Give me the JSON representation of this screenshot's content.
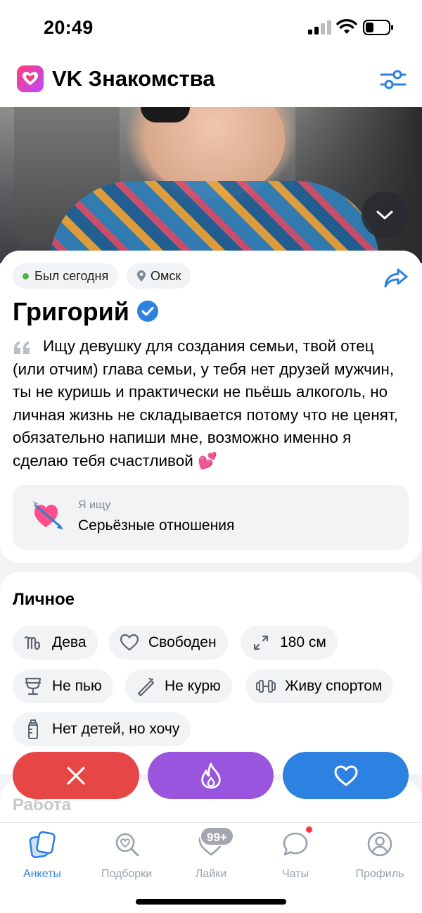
{
  "status_bar": {
    "time": "20:49"
  },
  "app": {
    "title": "VK Знакомства",
    "icons": [
      "vk-dating-logo-icon",
      "filter-sliders-icon"
    ]
  },
  "profile": {
    "last_seen": "Был сегодня",
    "city": "Омск",
    "name": "Григорий",
    "verified": true,
    "about": "Ищу девушку для создания семьи, твой отец (или отчим) глава семьи, у тебя нет друзей мужчин, ты не куришь и практически не пьёшь алкоголь, но личная жизнь не складывается потому что не ценят, обязательно напиши мне, возможно именно я сделаю тебя счастливой 💕",
    "looking_for": {
      "label": "Я ищу",
      "value": "Серьёзные отношения",
      "emoji": "💘"
    }
  },
  "personal": {
    "title": "Личное",
    "tags": [
      {
        "icon": "virgo-icon",
        "label": "Дева"
      },
      {
        "icon": "heart-outline-icon",
        "label": "Свободен"
      },
      {
        "icon": "height-arrows-icon",
        "label": "180 см"
      },
      {
        "icon": "glass-icon",
        "label": "Не пью"
      },
      {
        "icon": "no-smoking-icon",
        "label": "Не курю"
      },
      {
        "icon": "dumbbell-icon",
        "label": "Живу спортом"
      },
      {
        "icon": "baby-bottle-icon",
        "label": "Нет детей, но хочу"
      }
    ]
  },
  "work": {
    "title": "Работа"
  },
  "actions": {
    "icons": [
      "dislike-x-icon",
      "superlike-flame-icon",
      "like-heart-icon"
    ]
  },
  "tabbar": {
    "tabs": [
      {
        "label": "Анкеты",
        "active": true
      },
      {
        "label": "Подборки",
        "active": false
      },
      {
        "label": "Лайки",
        "active": false,
        "badge": "99+"
      },
      {
        "label": "Чаты",
        "active": false,
        "dot": true
      },
      {
        "label": "Профиль",
        "active": false
      }
    ]
  },
  "colors": {
    "accent": "#2d81e0",
    "dislike": "#e64646",
    "superlike": "#9955dd",
    "online": "#4bb34b"
  }
}
